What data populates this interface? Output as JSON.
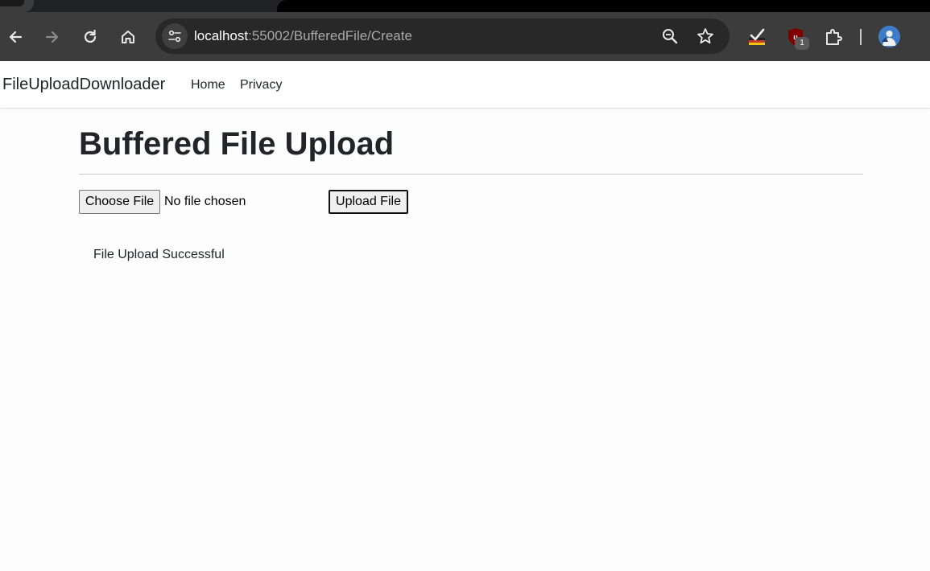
{
  "browser": {
    "url_host": "localhost",
    "url_path": ":55002/BufferedFile/Create",
    "icons": [
      "back-icon",
      "forward-icon",
      "reload-icon",
      "home-icon",
      "site-info-icon",
      "zoom-icon",
      "bookmark-star-icon",
      "check-extension-icon",
      "ublock-extension-icon",
      "extensions-puzzle-icon",
      "profile-avatar"
    ],
    "extension_badge": "1",
    "colors": {
      "toolbar": "#3c3c3c",
      "omnibox": "#282828",
      "tabstrip": "#202124"
    }
  },
  "navbar": {
    "brand": "FileUploadDownloader",
    "links": [
      "Home",
      "Privacy"
    ]
  },
  "main": {
    "title": "Buffered File Upload",
    "file_input": {
      "button_label": "Choose File",
      "status": "No file chosen"
    },
    "upload_button": "Upload File",
    "message": "File Upload Successful"
  }
}
